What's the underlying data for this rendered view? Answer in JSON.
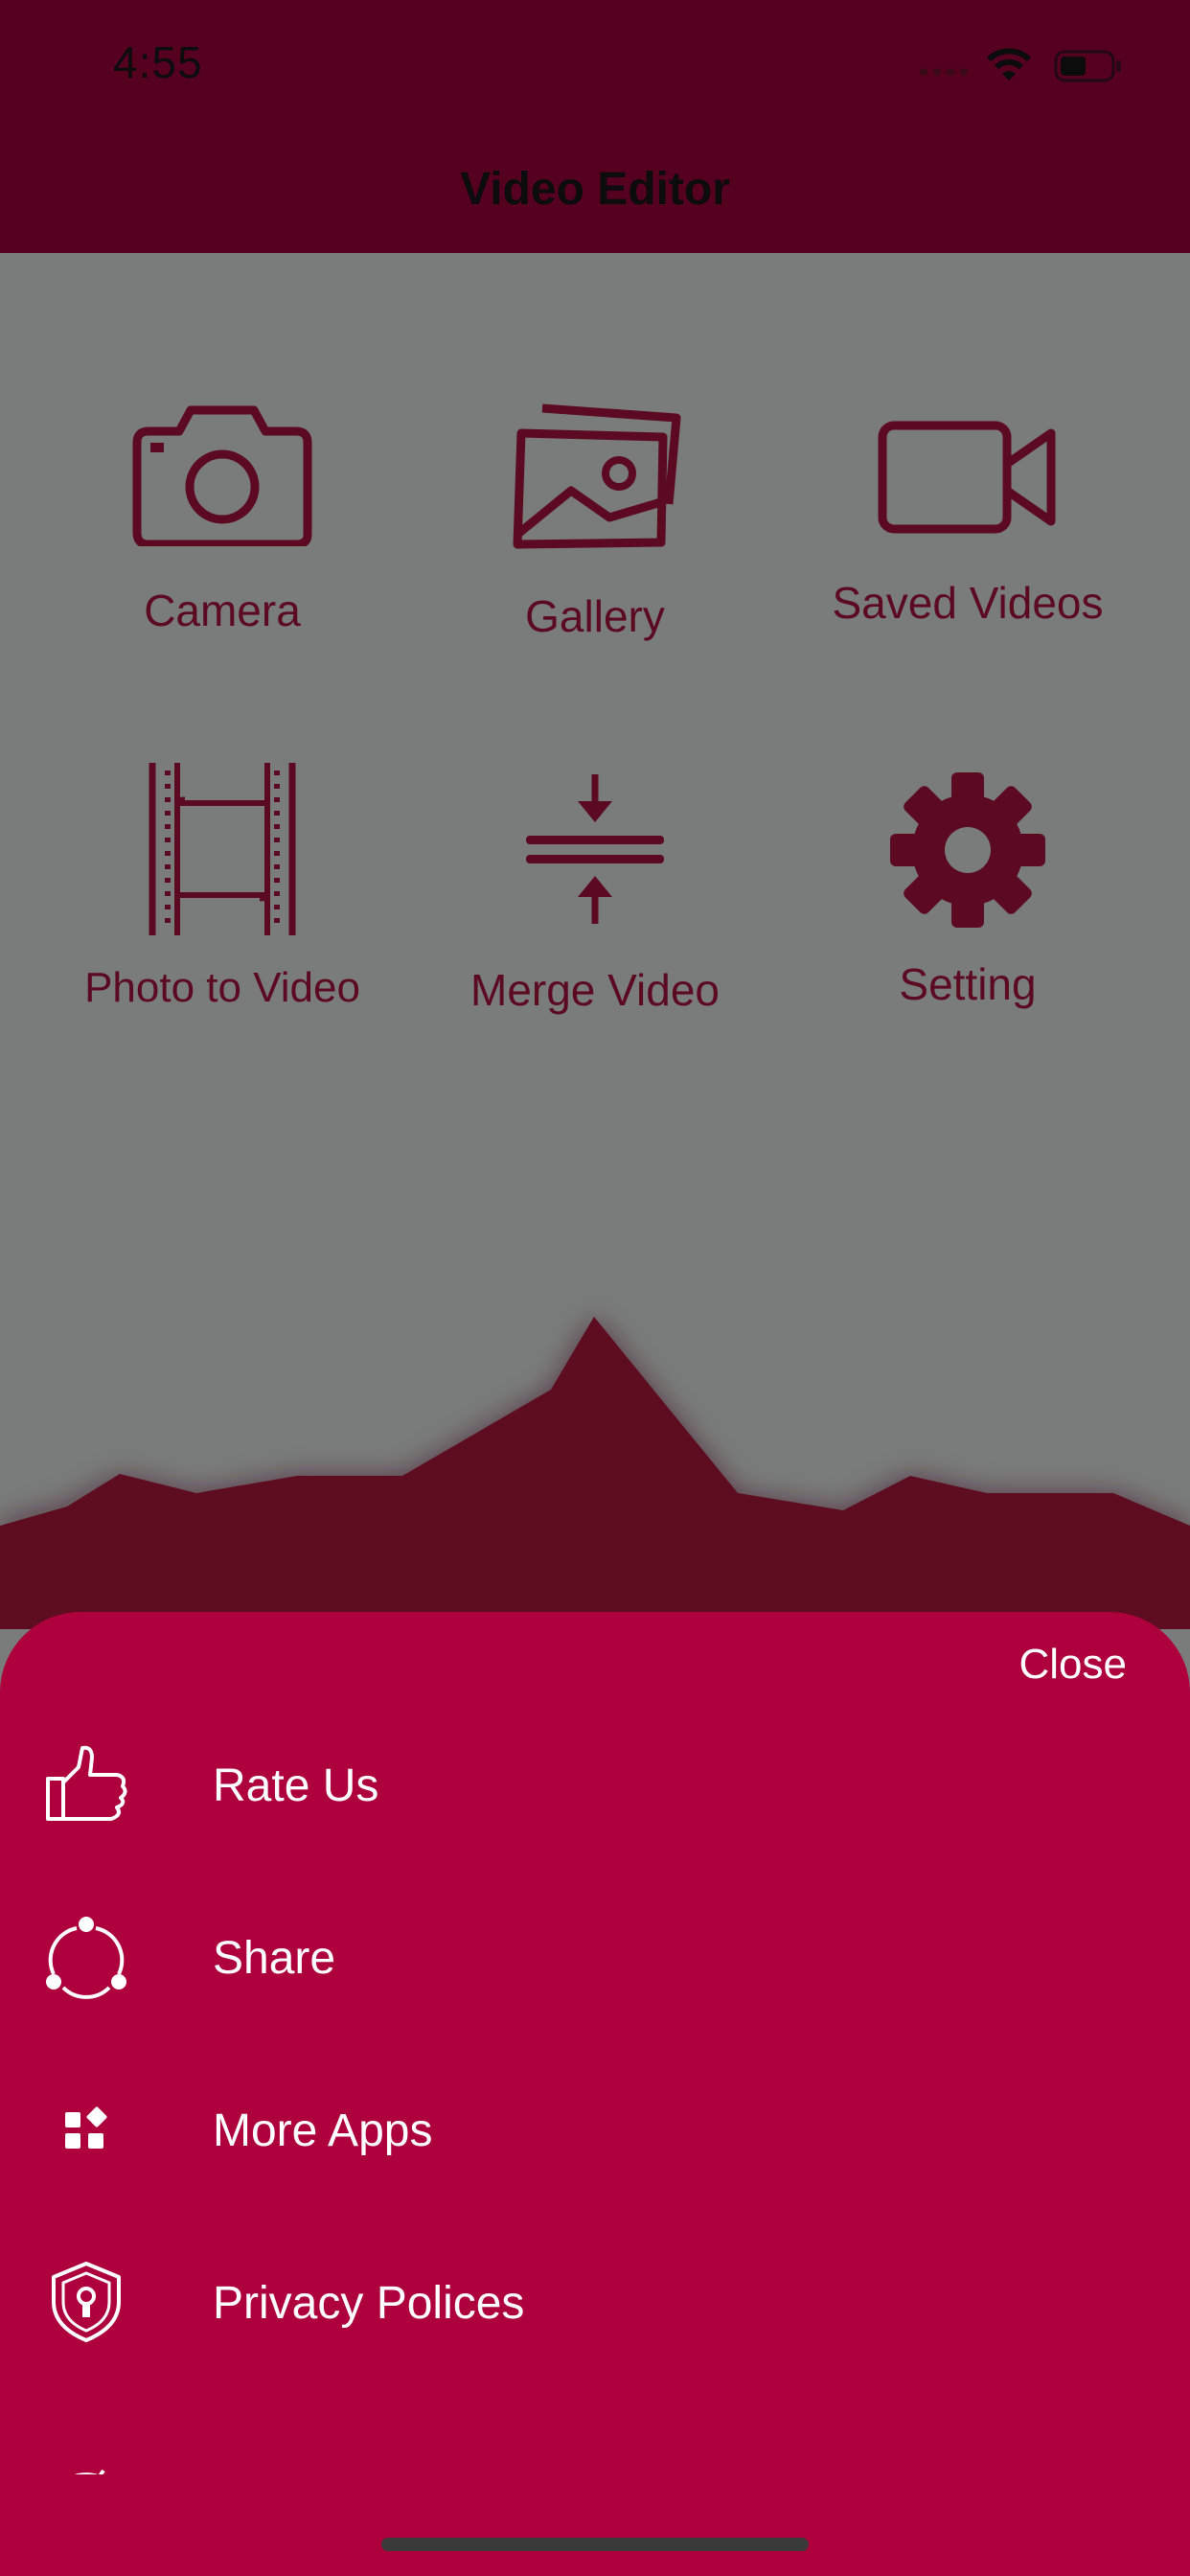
{
  "status_bar": {
    "time": "4:55"
  },
  "nav": {
    "title": "Video Editor"
  },
  "grid": {
    "camera": "Camera",
    "gallery": "Gallery",
    "saved_videos": "Saved Videos",
    "photo_to_video": "Photo to Video",
    "merge_video": "Merge Video",
    "setting": "Setting"
  },
  "sheet": {
    "close": "Close",
    "items": [
      {
        "label": "Rate Us",
        "icon": "thumbs-up-icon"
      },
      {
        "label": "Share",
        "icon": "share-icon"
      },
      {
        "label": "More Apps",
        "icon": "apps-icon"
      },
      {
        "label": "Privacy Polices",
        "icon": "shield-lock-icon"
      }
    ]
  },
  "colors": {
    "accent": "#ad003c",
    "header": "#560020",
    "icon": "#5b0a22",
    "overlay": "#7a7c7c"
  }
}
